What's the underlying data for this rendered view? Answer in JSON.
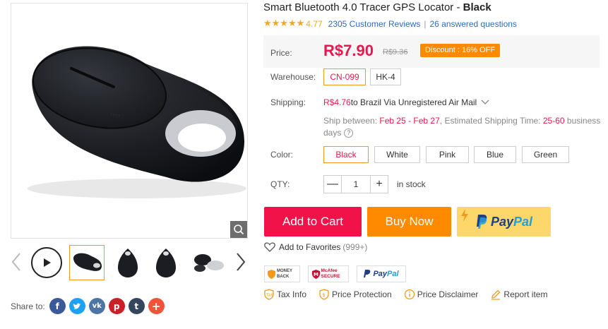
{
  "product": {
    "title": "Smart Bluetooth 4.0 Tracer GPS Locator - ",
    "title_color": "Black",
    "rating": "4.77",
    "reviews": "2305 Customer Reviews",
    "separator": "|",
    "questions": "26 answered questions"
  },
  "price": {
    "label": "Price:",
    "current": "R$7.90",
    "original": "R$9.36",
    "discount": "Discount : 16% OFF"
  },
  "warehouse": {
    "label": "Warehouse:",
    "options": [
      "CN-099",
      "HK-4"
    ],
    "selected": "CN-099"
  },
  "shipping": {
    "label": "Shipping:",
    "cost": "R$4.76",
    "method": " to Brazil Via Unregistered Air Mail",
    "between_label": "Ship between: ",
    "between_dates": "Feb 25 - Feb 27",
    "estimated_label": ", Estimated Shipping Time: ",
    "estimated_value": "25-60",
    "estimated_unit": " business days"
  },
  "color": {
    "label": "Color:",
    "options": [
      "Black",
      "White",
      "Pink",
      "Blue",
      "Green"
    ],
    "selected": "Black"
  },
  "qty": {
    "label": "QTY:",
    "value": "1",
    "minus": "—",
    "plus": "+",
    "stock": "in stock"
  },
  "actions": {
    "add_to_cart": "Add to Cart",
    "buy_now": "Buy Now",
    "paypal_pay": "Pay",
    "paypal_pal": "Pal",
    "favorites": "Add to Favorites",
    "favorites_count": "(999+)"
  },
  "badges": {
    "money_back": "MONEY BACK",
    "mcafee": "McAfee SECURE",
    "paypal_pay": "Pay",
    "paypal_pal": "Pal"
  },
  "info": {
    "tax": "Tax Info",
    "protection": "Price Protection",
    "disclaimer": "Price Disclaimer",
    "report": "Report item"
  },
  "share": {
    "label": "Share to:",
    "networks": [
      "f",
      "t",
      "vk",
      "p",
      "t",
      "+"
    ]
  },
  "colors": {
    "accent_red": "#e8184e",
    "orange": "#ff8a00",
    "link_blue": "#2f6bbf",
    "paypal_yellow": "#fdd76a"
  }
}
